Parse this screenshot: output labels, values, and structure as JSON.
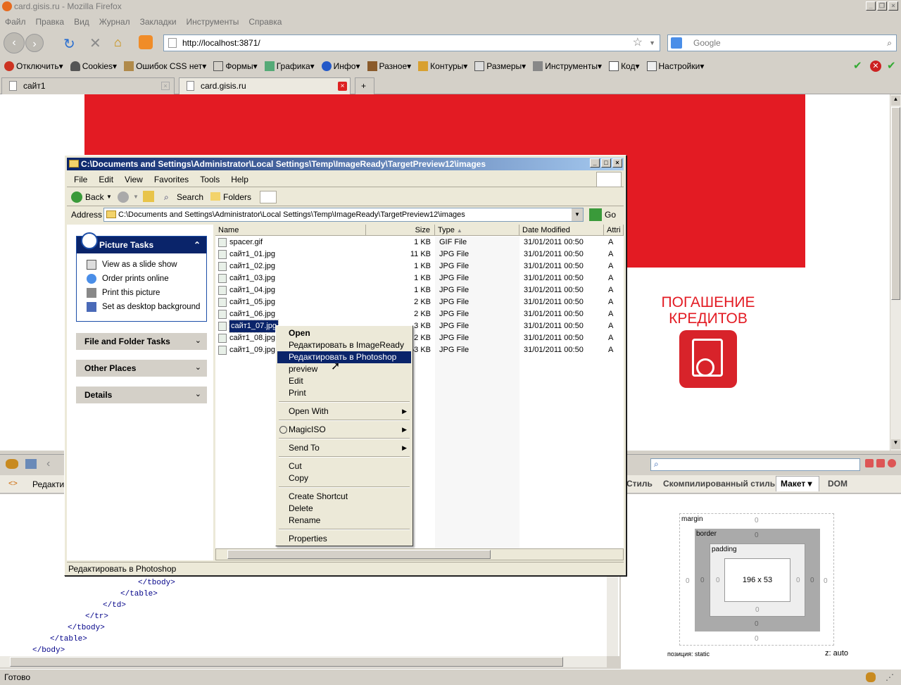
{
  "firefox": {
    "title": "card.gisis.ru - Mozilla Firefox",
    "menu": [
      "Файл",
      "Правка",
      "Вид",
      "Журнал",
      "Закладки",
      "Инструменты",
      "Справка"
    ],
    "url": "http://localhost:3871/",
    "search_placeholder": "Google",
    "devtoolbar": [
      "Отключить",
      "Cookies",
      "Ошибок CSS нет",
      "Формы",
      "Графика",
      "Инфо",
      "Разное",
      "Контуры",
      "Размеры",
      "Инструменты",
      "Код",
      "Настройки"
    ],
    "tabs": [
      "сайт1",
      "card.gisis.ru"
    ],
    "status": "Готово"
  },
  "page": {
    "promo_title": "ПОГАШЕНИЕ\nКРЕДИТОВ",
    "promo_line1": "ПОГАШЕНИЕ",
    "promo_line2": "КРЕДИТОВ"
  },
  "firebug": {
    "left_tab": "Редакти",
    "right_tabs": [
      "Стиль",
      "Скомпилированный стиль",
      "Макет",
      "DOM"
    ],
    "code_lines": [
      "</tbody>",
      "</table>",
      "</td>",
      "</tr>",
      "</tbody>",
      "</table>",
      "</body>"
    ],
    "layout": {
      "margin_label": "margin",
      "border_label": "border",
      "padding_label": "padding",
      "size": "196 x 53",
      "zero": "0",
      "position": "позиция: static",
      "z": "z: auto"
    }
  },
  "explorer": {
    "title": "C:\\Documents and Settings\\Administrator\\Local Settings\\Temp\\ImageReady\\TargetPreview12\\images",
    "menu": [
      "File",
      "Edit",
      "View",
      "Favorites",
      "Tools",
      "Help"
    ],
    "toolbar": {
      "back": "Back",
      "search": "Search",
      "folders": "Folders"
    },
    "address_label": "Address",
    "address": "C:\\Documents and Settings\\Administrator\\Local Settings\\Temp\\ImageReady\\TargetPreview12\\images",
    "go": "Go",
    "picture_tasks": {
      "title": "Picture Tasks",
      "items": [
        "View as a slide show",
        "Order prints online",
        "Print this picture",
        "Set as desktop background"
      ]
    },
    "other_panels": [
      "File and Folder Tasks",
      "Other Places",
      "Details"
    ],
    "columns": [
      "Name",
      "Size",
      "Type",
      "Date Modified",
      "Attri"
    ],
    "files": [
      {
        "name": "spacer.gif",
        "size": "1 KB",
        "type": "GIF File",
        "date": "31/01/2011 00:50",
        "attr": "A"
      },
      {
        "name": "сайт1_01.jpg",
        "size": "11 KB",
        "type": "JPG File",
        "date": "31/01/2011 00:50",
        "attr": "A"
      },
      {
        "name": "сайт1_02.jpg",
        "size": "1 KB",
        "type": "JPG File",
        "date": "31/01/2011 00:50",
        "attr": "A"
      },
      {
        "name": "сайт1_03.jpg",
        "size": "1 KB",
        "type": "JPG File",
        "date": "31/01/2011 00:50",
        "attr": "A"
      },
      {
        "name": "сайт1_04.jpg",
        "size": "1 KB",
        "type": "JPG File",
        "date": "31/01/2011 00:50",
        "attr": "A"
      },
      {
        "name": "сайт1_05.jpg",
        "size": "2 KB",
        "type": "JPG File",
        "date": "31/01/2011 00:50",
        "attr": "A"
      },
      {
        "name": "сайт1_06.jpg",
        "size": "2 KB",
        "type": "JPG File",
        "date": "31/01/2011 00:50",
        "attr": "A"
      },
      {
        "name": "сайт1_07.jpg",
        "size": "3 KB",
        "type": "JPG File",
        "date": "31/01/2011 00:50",
        "attr": "A"
      },
      {
        "name": "сайт1_08.jpg",
        "size": "2 KB",
        "type": "JPG File",
        "date": "31/01/2011 00:50",
        "attr": "A"
      },
      {
        "name": "сайт1_09.jpg",
        "size": "53 KB",
        "type": "JPG File",
        "date": "31/01/2011 00:50",
        "attr": "A"
      }
    ],
    "status": "Редактировать в Photoshop"
  },
  "context_menu": {
    "items": [
      "Open",
      "Редактировать в ImageReady",
      "Редактировать в Photoshop",
      "preview",
      "Edit",
      "Print",
      "Open With",
      "MagicISO",
      "Send To",
      "Cut",
      "Copy",
      "Create Shortcut",
      "Delete",
      "Rename",
      "Properties"
    ]
  },
  "colors": {
    "brand_red": "#e31b23",
    "selection": "#0a246a"
  }
}
